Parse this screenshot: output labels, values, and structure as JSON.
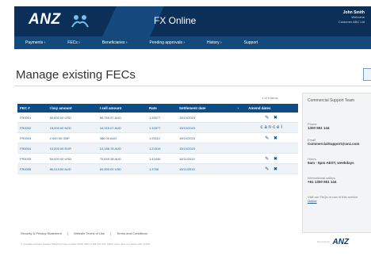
{
  "header": {
    "logo": "ANZ",
    "app_title": "FX Online",
    "user_name": "John Smith",
    "user_line1": "Welcome",
    "user_line2": "Customer ABC Ltd"
  },
  "nav": {
    "items": [
      "Payments ›",
      "FECs ›",
      "Beneficiaries ›",
      "Pending approvals ›",
      "History ›",
      "Support"
    ]
  },
  "main": {
    "title": "Manage existing FECs",
    "count": "1 of 6 items"
  },
  "table": {
    "headers": [
      "FEC #",
      "I buy amount",
      "I sell amount",
      "Rate",
      "Settlement date",
      "›",
      "Amend dates"
    ],
    "rows": [
      [
        "FR0001",
        "50,000.00 USD",
        "66,755.97 AUD",
        "1.33077",
        "15/10/2015",
        "",
        "✎ ✖"
      ],
      [
        "FR0002",
        "15,000.00 NZD",
        "16,315.07 AUD",
        "1.10577",
        "15/10/2015",
        "",
        "cancel"
      ],
      [
        "FR0003",
        "2,000.00 GBP",
        "386.00 AUD",
        "1.93112",
        "15/10/2015",
        "",
        "✎ ✖"
      ],
      [
        "FR0004",
        "10,000.00 EUR",
        "14,186.78 AUD",
        "1.21819",
        "15/10/2015",
        "",
        ""
      ],
      [
        "FR0005",
        "50,000.00 USD",
        "70,849.38 AUD",
        "1.41646",
        "15/11/2015",
        "",
        "✎ ✖"
      ],
      [
        "FR0006",
        "86,013.50 AUD",
        "60,000.00 USD",
        "1.3766",
        "15/11/2015",
        "",
        "✎ ✖"
      ]
    ]
  },
  "sidebar": {
    "title": "Commercial Support Team",
    "phone_label": "Phone",
    "phone_value": "1300 651 144",
    "email_label": "Email",
    "email_value": "CommercialSupport@anz.com",
    "hours_label": "Hours",
    "hours_value": "9am - 5pm AEST, weekdays",
    "intl_label": "International callers",
    "intl_value": "+61 1300 651 144",
    "faq_text": "Visit our FAQs or use of this service",
    "faq_link": "Online"
  },
  "footer": {
    "links": [
      "Security & Privacy Statement",
      "|",
      "Website Terms of Use",
      "|",
      "Terms and Conditions"
    ],
    "legal": "© Australia and New Zealand Banking Group Limited (ANZ) ABN 11 005 357 522. ANZ's colour blue is a trade mark of ANZ.",
    "site": "anz.com.au",
    "logo": "ANZ"
  }
}
